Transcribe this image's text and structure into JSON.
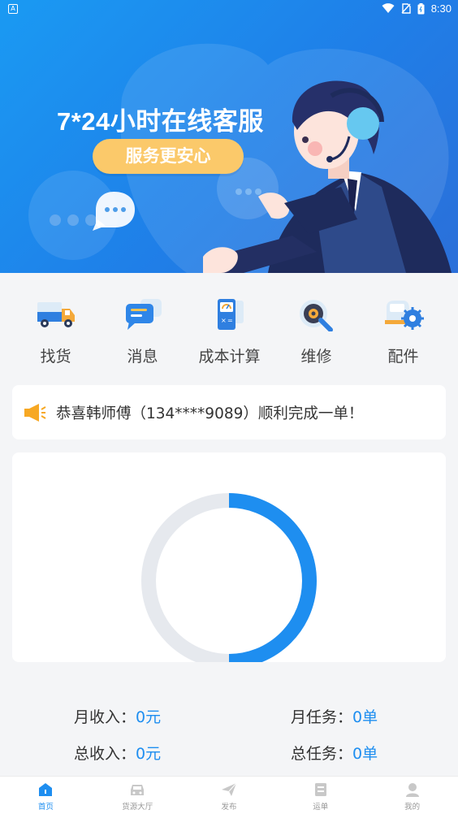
{
  "status_bar": {
    "time": "8:30",
    "left_glyph": "A"
  },
  "banner": {
    "title": "7*24小时在线客服",
    "pill": "服务更安心"
  },
  "menu": [
    {
      "label": "找货",
      "icon": "truck-icon"
    },
    {
      "label": "消息",
      "icon": "message-icon"
    },
    {
      "label": "成本计算",
      "icon": "calculator-icon"
    },
    {
      "label": "维修",
      "icon": "repair-icon"
    },
    {
      "label": "配件",
      "icon": "parts-icon"
    }
  ],
  "notice": {
    "icon": "megaphone-icon",
    "text": "恭喜韩师傅（134****9089）顺利完成一单！"
  },
  "chart_data": {
    "type": "pie",
    "style": "donut",
    "slices": [
      {
        "value": 50,
        "color": "#1e8ef0"
      },
      {
        "value": 50,
        "color": "#e6e9ee"
      }
    ]
  },
  "stats": {
    "month_income_label": "月收入：",
    "month_income_value": "0元",
    "month_tasks_label": "月任务：",
    "month_tasks_value": "0单",
    "total_income_label": "总收入：",
    "total_income_value": "0元",
    "total_tasks_label": "总任务：",
    "total_tasks_value": "0单"
  },
  "tabbar": [
    {
      "label": "首页",
      "icon": "home-icon",
      "active": true
    },
    {
      "label": "货源大厅",
      "icon": "cargo-hall-icon",
      "active": false
    },
    {
      "label": "发布",
      "icon": "send-icon",
      "active": false
    },
    {
      "label": "运单",
      "icon": "waybill-icon",
      "active": false
    },
    {
      "label": "我的",
      "icon": "profile-icon",
      "active": false
    }
  ],
  "colors": {
    "primary": "#1e8ef0",
    "banner_pill": "#fbc96a",
    "notice_icon": "#f7a823"
  }
}
